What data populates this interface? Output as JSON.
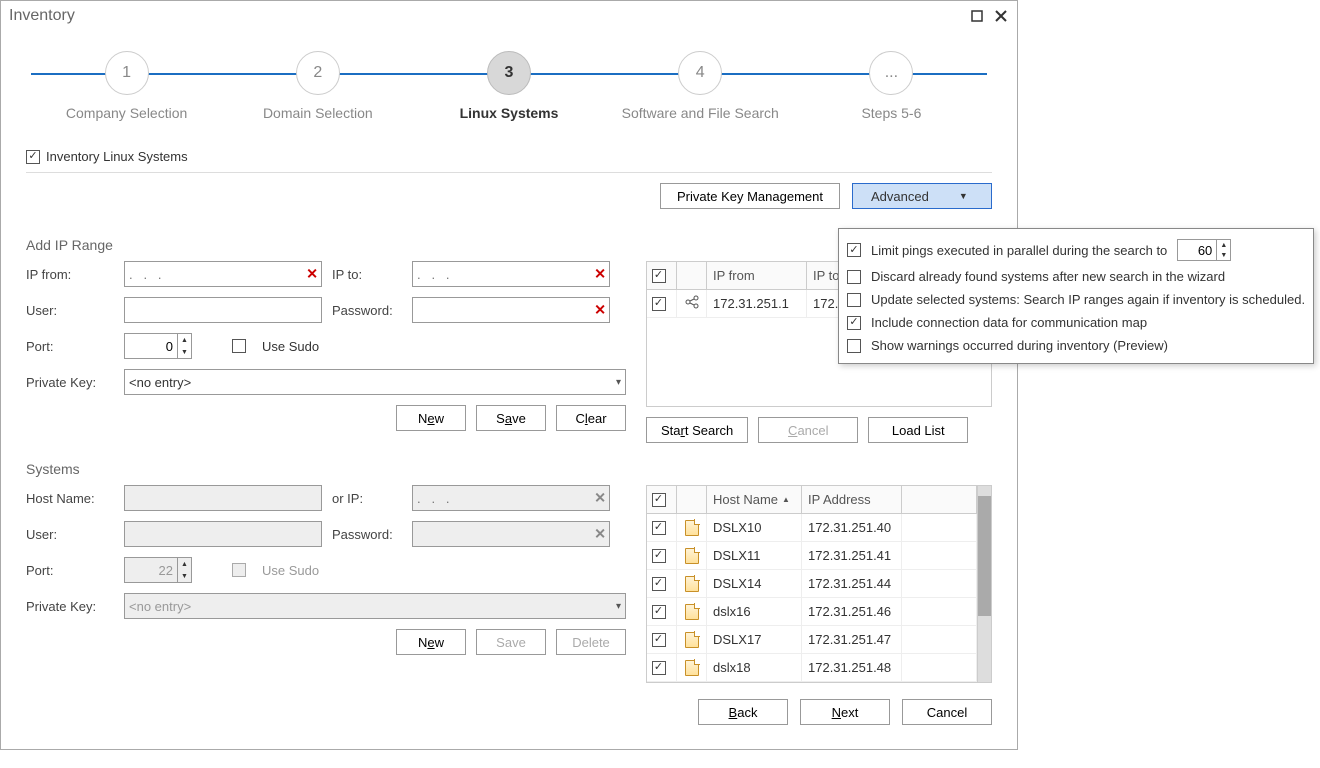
{
  "window": {
    "title": "Inventory"
  },
  "steps": [
    {
      "num": "1",
      "label": "Company Selection"
    },
    {
      "num": "2",
      "label": "Domain Selection"
    },
    {
      "num": "3",
      "label": "Linux Systems"
    },
    {
      "num": "4",
      "label": "Software and File Search"
    },
    {
      "num": "...",
      "label": "Steps 5-6"
    }
  ],
  "main_checkbox": "Inventory Linux Systems",
  "buttons": {
    "private_key_mgmt": "Private Key Management",
    "advanced": "Advanced",
    "new": "New",
    "save": "Save",
    "clear": "Clear",
    "start_search": "Start Search",
    "cancel": "Cancel",
    "load_list": "Load List",
    "delete": "Delete",
    "back": "Back",
    "next": "Next"
  },
  "sections": {
    "add_range": "Add IP Range",
    "systems": "Systems"
  },
  "labels": {
    "ip_from": "IP from:",
    "ip_to": "IP to:",
    "user": "User:",
    "password": "Password:",
    "port": "Port:",
    "use_sudo": "Use Sudo",
    "private_key": "Private Key:",
    "host_name": "Host Name:",
    "or_ip": "or  IP:",
    "no_entry": "<no entry>",
    "dots": ".   .   .",
    "port_zero": "0",
    "port_22": "22"
  },
  "range_table": {
    "headers": {
      "ip_from": "IP from",
      "ip_to": "IP to"
    },
    "rows": [
      {
        "ip_from": "172.31.251.1",
        "ip_to": "172.3"
      }
    ]
  },
  "systems_table": {
    "headers": {
      "host": "Host Name",
      "ip": "IP Address"
    },
    "rows": [
      {
        "host": "DSLX10",
        "ip": "172.31.251.40"
      },
      {
        "host": "DSLX11",
        "ip": "172.31.251.41"
      },
      {
        "host": "DSLX14",
        "ip": "172.31.251.44"
      },
      {
        "host": "dslx16",
        "ip": "172.31.251.46"
      },
      {
        "host": "DSLX17",
        "ip": "172.31.251.47"
      },
      {
        "host": "dslx18",
        "ip": "172.31.251.48"
      }
    ]
  },
  "advanced_popup": {
    "limit_pings": "Limit pings executed in parallel during the search to",
    "limit_value": "60",
    "discard": "Discard already found systems after new search in the wizard",
    "update": "Update selected systems: Search IP ranges again if inventory is scheduled.",
    "include": "Include connection data for communication map",
    "warnings": "Show warnings occurred during inventory (Preview)"
  }
}
